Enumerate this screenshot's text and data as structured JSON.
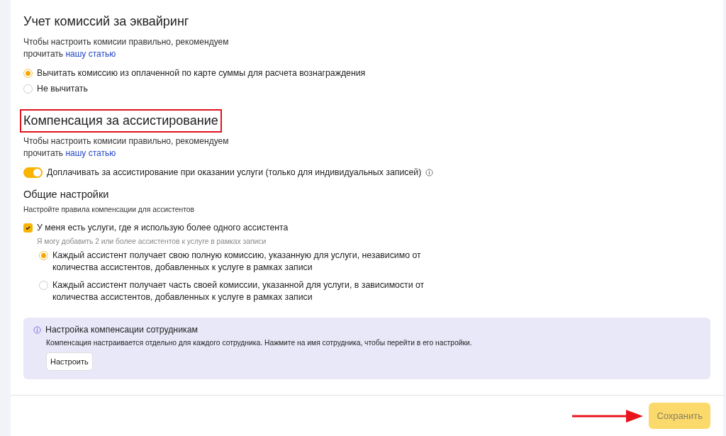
{
  "sections": [
    {
      "title": "Учет комиссий за эквайринг",
      "highlighted": false,
      "description": [
        "Чтобы настроить комисии правильно, рекомендуем",
        "прочитать"
      ],
      "link": "нашу статью",
      "options": [
        {
          "label": "Вычитать комиссию из оплаченной по карте суммы для расчета вознаграждения",
          "selected": true
        },
        {
          "label": "Не вычитать",
          "selected": false
        }
      ]
    },
    {
      "title": "Компенсация за ассистирование",
      "highlighted": true,
      "description": [
        "Чтобы настроить комисии правильно, рекомендуем",
        "прочитать"
      ],
      "link": "нашу статью",
      "toggle": {
        "label": "Доплачивать за ассистирование при оказании услуги (только для индивидуальных записей)",
        "on": true
      },
      "general": {
        "title": "Общие настройки",
        "hint": "Настройте правила компенсации для ассистентов",
        "checkbox": {
          "label": "У меня есть услуги, где я использую более одного ассистента",
          "checked": true,
          "hint": "Я могу добавить 2 или более ассистентов к услуге в рамках записи"
        },
        "options": [
          {
            "label": "Каждый ассистент получает свою полную комиссию, указанную для услуги, независимо от количества ассистентов, добавленных к услуге в рамках записи",
            "selected": true
          },
          {
            "label": "Каждый ассистент получает часть своей комиссии, указанной для услуги, в зависимости от количества ассистентов, добавленных к услуге в рамках записи",
            "selected": false
          }
        ]
      }
    }
  ],
  "info_box": {
    "title": "Настройка компенсации сотрудникам",
    "text": "Компенсация настраивается отдельно для каждого сотрудника. Нажмите на имя сотрудника, чтобы перейти в его настройки.",
    "button": "Настроить"
  },
  "footer": {
    "save_button": {
      "label": "Сохранить",
      "disabled": true
    },
    "pointer_arrow": true
  }
}
